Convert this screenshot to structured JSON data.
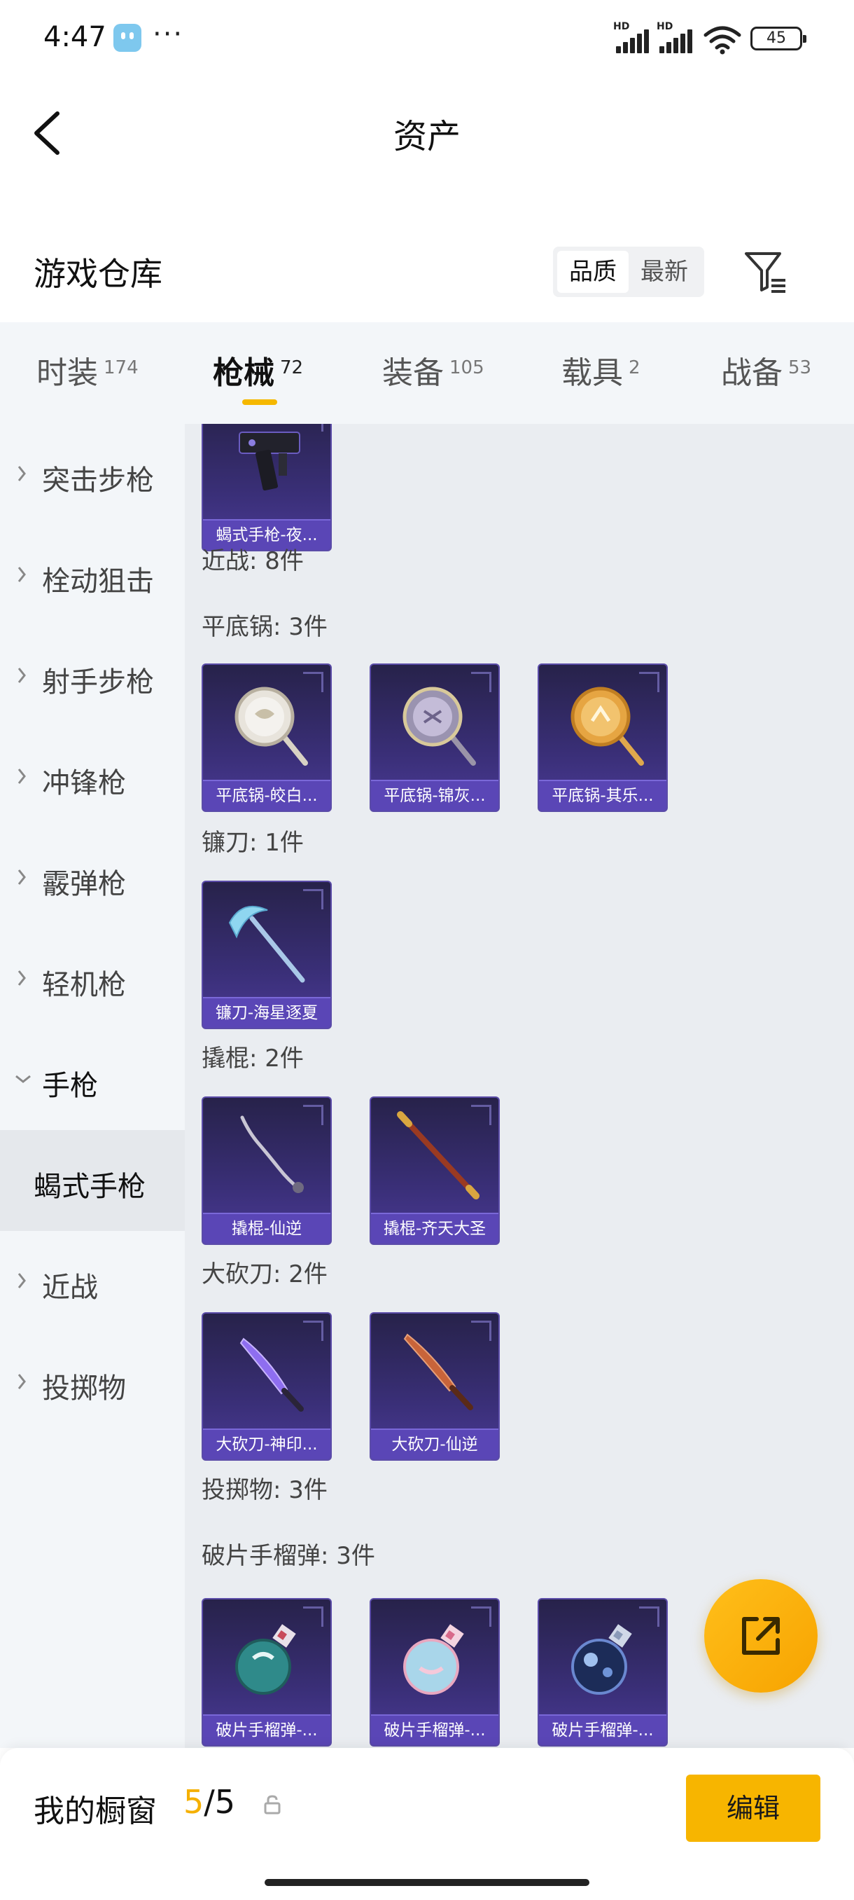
{
  "status_bar": {
    "time": "4:47",
    "more": "···",
    "hd_1": "HD",
    "hd_2": "HD",
    "battery": "45"
  },
  "header": {
    "title": "资产"
  },
  "warehouse": {
    "title": "游戏仓库",
    "sort_options": [
      "品质",
      "最新"
    ],
    "active_sort": "品质"
  },
  "tabs": [
    {
      "label": "时装",
      "count": "174"
    },
    {
      "label": "枪械",
      "count": "72"
    },
    {
      "label": "装备",
      "count": "105"
    },
    {
      "label": "载具",
      "count": "2"
    },
    {
      "label": "战备",
      "count": "53"
    }
  ],
  "active_tab": "枪械",
  "sidebar": {
    "items": [
      {
        "label": "突击步枪"
      },
      {
        "label": "栓动狙击"
      },
      {
        "label": "射手步枪"
      },
      {
        "label": "冲锋枪"
      },
      {
        "label": "霰弹枪"
      },
      {
        "label": "轻机枪"
      },
      {
        "label": "手枪"
      },
      {
        "label": "蝎式手枪"
      },
      {
        "label": "近战"
      },
      {
        "label": "投掷物"
      }
    ]
  },
  "content": {
    "sections": [
      {
        "label": "近战: 8件"
      },
      {
        "label": "平底锅: 3件"
      },
      {
        "label": "镰刀: 1件"
      },
      {
        "label": "撬棍: 2件"
      },
      {
        "label": "大砍刀: 2件"
      },
      {
        "label": "投掷物: 3件"
      },
      {
        "label": "破片手榴弹: 3件"
      }
    ],
    "cards": [
      {
        "name": "蝎式手枪-夜...",
        "icon": "pistol-icon"
      },
      {
        "name": "平底锅-皎白...",
        "icon": "frying-pan-white-icon"
      },
      {
        "name": "平底锅-锦灰...",
        "icon": "frying-pan-grey-icon"
      },
      {
        "name": "平底锅-其乐...",
        "icon": "frying-pan-gold-icon"
      },
      {
        "name": "镰刀-海星逐夏",
        "icon": "sickle-icon"
      },
      {
        "name": "撬棍-仙逆",
        "icon": "crowbar-icon"
      },
      {
        "name": "撬棍-齐天大圣",
        "icon": "staff-icon"
      },
      {
        "name": "大砍刀-神印...",
        "icon": "machete-purple-icon"
      },
      {
        "name": "大砍刀-仙逆",
        "icon": "machete-copper-icon"
      },
      {
        "name": "破片手榴弹-...",
        "icon": "grenade-teal-icon"
      },
      {
        "name": "破片手榴弹-...",
        "icon": "grenade-light-icon"
      },
      {
        "name": "破片手榴弹-...",
        "icon": "grenade-dark-icon"
      }
    ]
  },
  "showcase": {
    "title": "我的橱窗",
    "current": "5",
    "separator": "/",
    "total": "5",
    "edit_label": "编辑"
  },
  "colors": {
    "accent": "#f7b500",
    "card_bg": "#3a2f78",
    "caption_bg": "#5a46b6",
    "tab_underline": "#f5b800"
  }
}
